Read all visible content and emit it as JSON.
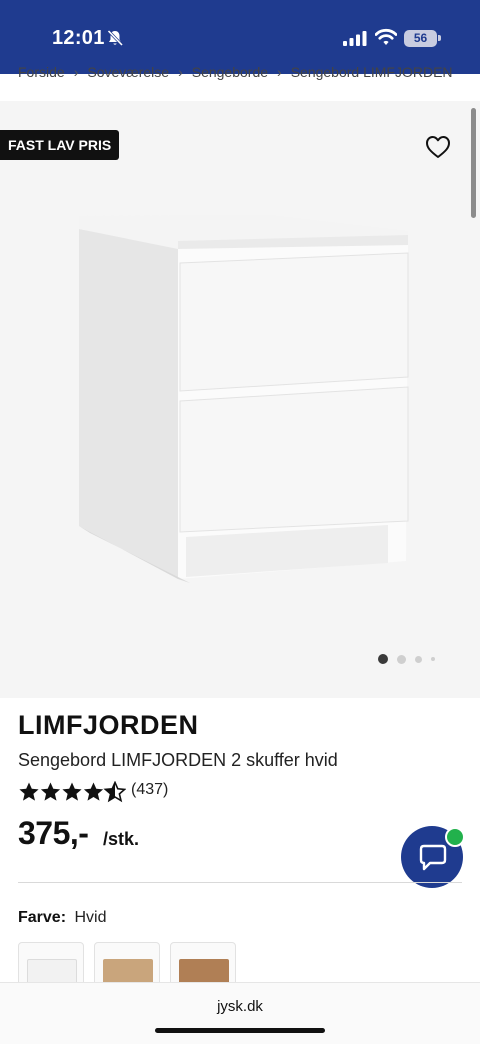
{
  "status_bar": {
    "time": "12:01",
    "battery": "56"
  },
  "breadcrumb": [
    "Forside",
    "Soveværelse",
    "Sengeborde",
    "Sengebord LIMFJORDEN"
  ],
  "gallery": {
    "badge": "FAST LAV PRIS",
    "image_count": 4,
    "active_image": 1
  },
  "product": {
    "brand": "LIMFJORDEN",
    "name": "Sengebord LIMFJORDEN 2 skuffer hvid",
    "rating": 4.5,
    "review_count": "(437)",
    "price": "375,-",
    "unit": "/stk."
  },
  "color": {
    "label": "Farve:",
    "value": "Hvid",
    "swatches": [
      {
        "name": "Hvid",
        "color": "#f2f2f2"
      },
      {
        "name": "Eg",
        "color": "#c9a57c"
      },
      {
        "name": "Eg mørk",
        "color": "#b07f55"
      }
    ]
  },
  "browser": {
    "url": "jysk.dk"
  },
  "colors": {
    "brand_blue": "#1f3b8f",
    "online_green": "#22b14c"
  },
  "icons": [
    "bell-off-icon",
    "signal-icon",
    "wifi-icon",
    "battery-icon",
    "heart-icon",
    "star-icon",
    "chat-icon"
  ]
}
